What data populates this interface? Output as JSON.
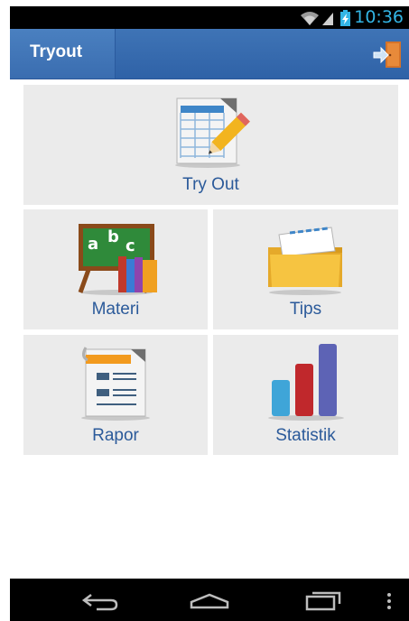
{
  "status_bar": {
    "time": "10:36",
    "icons": [
      "wifi-icon",
      "signal-icon",
      "battery-charging-icon"
    ]
  },
  "action_bar": {
    "title": "Tryout",
    "action_icon": "logout-door-icon"
  },
  "menu": {
    "tryout": {
      "label": "Try Out",
      "icon": "spreadsheet-pencil-icon"
    },
    "materi": {
      "label": "Materi",
      "icon": "chalkboard-books-icon"
    },
    "tips": {
      "label": "Tips",
      "icon": "folder-icon"
    },
    "rapor": {
      "label": "Rapor",
      "icon": "clipboard-report-icon"
    },
    "statistik": {
      "label": "Statistik",
      "icon": "bar-chart-icon"
    }
  },
  "nav_bar": {
    "icons": [
      "back-icon",
      "home-icon",
      "recent-apps-icon",
      "overflow-menu-icon"
    ]
  },
  "colors": {
    "accent": "#33b5e5",
    "action_bar": "#3a6cb0",
    "tile": "#ebebeb",
    "label": "#2b5a9a"
  }
}
